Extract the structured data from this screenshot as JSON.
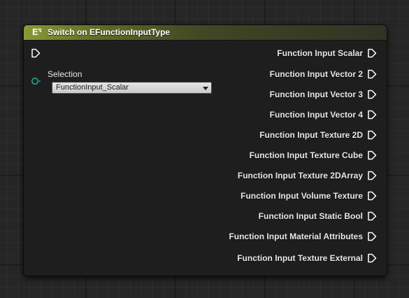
{
  "node": {
    "title": "Switch on EFunctionInputType",
    "header_icon": "E",
    "header_icon_sup": "↯",
    "selection_label": "Selection",
    "selection_value": "FunctionInput_Scalar",
    "outputs": [
      "Function Input Scalar",
      "Function Input Vector 2",
      "Function Input Vector 3",
      "Function Input Vector 4",
      "Function Input Texture 2D",
      "Function Input Texture Cube",
      "Function Input Texture 2DArray",
      "Function Input Volume Texture",
      "Function Input Static Bool",
      "Function Input Material Attributes",
      "Function Input Texture External"
    ]
  },
  "colors": {
    "header_accent": "#8a9a36",
    "selection_pin": "#1f9a8a",
    "exec_pin": "#ffffff"
  },
  "icons": {
    "header": "switch-enum-icon",
    "exec": "exec-pin-icon",
    "selection": "byte-pin-icon",
    "dropdown": "chevron-down-icon"
  }
}
